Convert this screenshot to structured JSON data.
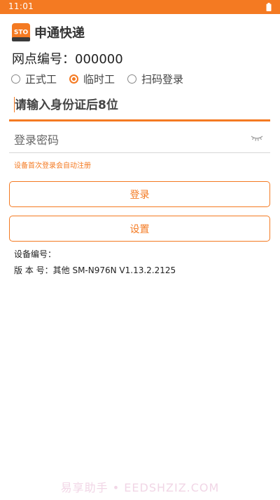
{
  "status_bar": {
    "time": "11:01",
    "battery_icon": "battery-icon",
    "bg_color": "#F47A22"
  },
  "header": {
    "logo_text": "STO",
    "app_title": "申通快递"
  },
  "site": {
    "label": "网点编号：",
    "value": "000000"
  },
  "login_type": {
    "options": [
      {
        "label": "正式工",
        "selected": false
      },
      {
        "label": "临时工",
        "selected": true
      },
      {
        "label": "扫码登录",
        "selected": false
      }
    ]
  },
  "form": {
    "id_placeholder": "请输入身份证后8位",
    "id_value": "",
    "password_placeholder": "登录密码",
    "password_value": "",
    "eye_icon": "eye-closed-icon",
    "hint": "设备首次登录会自动注册"
  },
  "buttons": {
    "login_label": "登录",
    "settings_label": "设置"
  },
  "info": {
    "device_label": "设备编号：",
    "device_value": "",
    "version_label": "版 本 号：",
    "version_value": "其他 SM-N976N V1.13.2.2125"
  },
  "watermark": "易享助手 • EEDSHZIZ.COM",
  "colors": {
    "accent": "#F47A22",
    "text": "#222222",
    "divider": "#d6d6d6"
  }
}
